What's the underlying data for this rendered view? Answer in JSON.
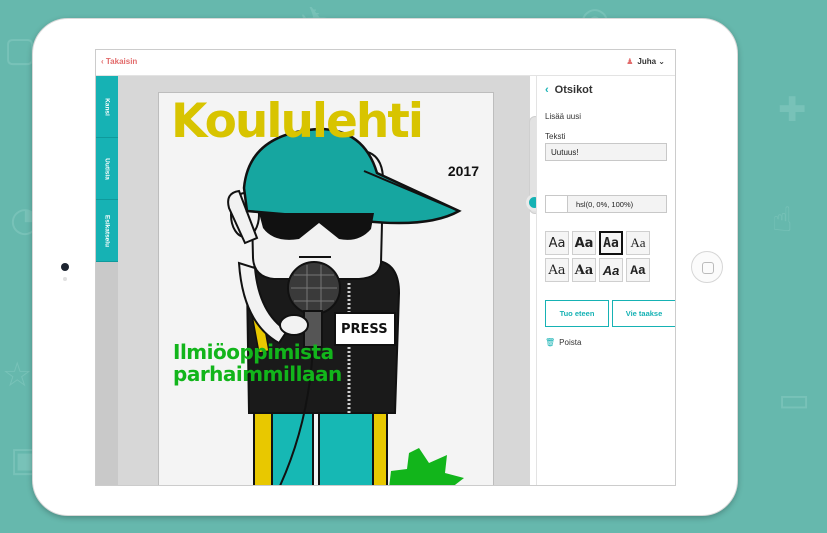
{
  "topbar": {
    "back_label": "Takaisin",
    "user_name": "Juha"
  },
  "sidebar": {
    "tabs": [
      {
        "label": "Kansi"
      },
      {
        "label": "Uutisia"
      },
      {
        "label": "Esikatselu"
      }
    ]
  },
  "cover": {
    "title": "Koululehti",
    "year": "2017",
    "badge": "PRESS",
    "headline_line1": "Ilmiöoppimista",
    "headline_line2": "parhaimmillaan"
  },
  "panel": {
    "heading": "Otsikot",
    "add_new_label": "Lisää uusi",
    "text_label": "Teksti",
    "text_value": "Uutuus!",
    "color_value": "hsl(0, 0%, 100%)",
    "font_samples": [
      "Aa",
      "Aa",
      "Aa",
      "Aa",
      "Aa",
      "Aa",
      "Aa",
      "Aa"
    ],
    "bring_forward_label": "Tuo eteen",
    "send_back_label": "Vie taakse",
    "delete_label": "Poista"
  },
  "colors": {
    "accent": "#16b2b4",
    "title_yellow": "#d8c400",
    "headline_green": "#12b51b",
    "back_red": "#e26b6b",
    "background": "#66b8ad"
  }
}
